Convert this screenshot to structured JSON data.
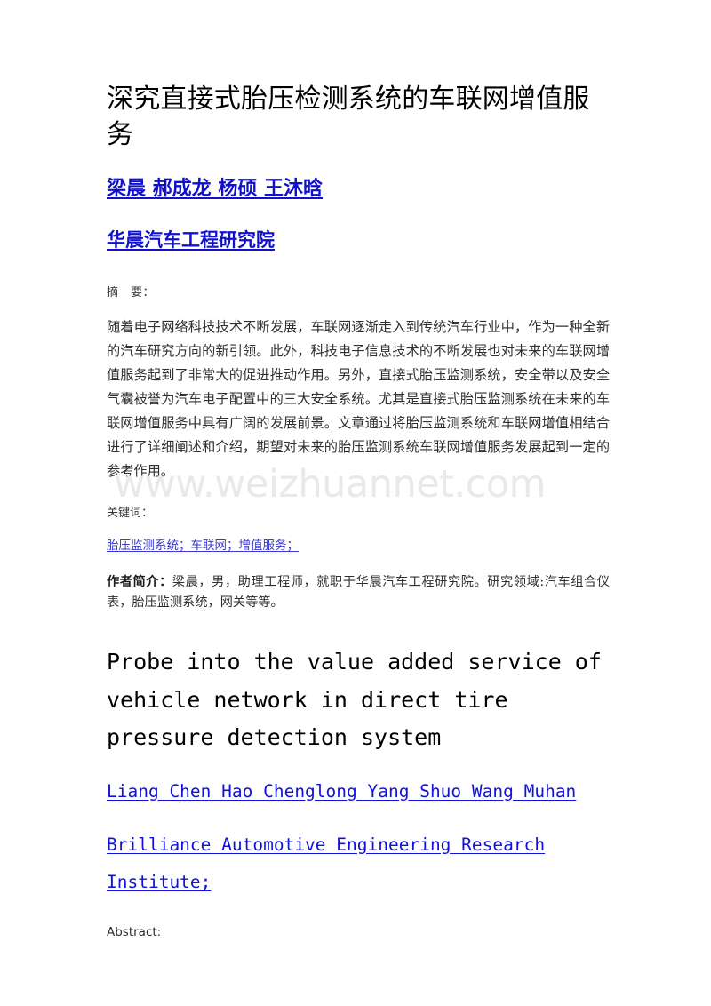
{
  "document": {
    "background_color": "#ffffff",
    "link_color": "#1111cc",
    "body_text_color": "#2f2f2f"
  },
  "chinese": {
    "title": "深究直接式胎压检测系统的车联网增值服务",
    "authors": "梁晨  郝成龙  杨硕  王沐晗",
    "institute": "华晨汽车工程研究院",
    "abstract_label": "摘　要：",
    "abstract_body": "随着电子网络科技技术不断发展，车联网逐渐走入到传统汽车行业中，作为一种全新的汽车研究方向的新引领。此外，科技电子信息技术的不断发展也对未来的车联网增值服务起到了非常大的促进推动作用。另外，直接式胎压监测系统，安全带以及安全气囊被誉为汽车电子配置中的三大安全系统。尤其是直接式胎压监测系统在未来的车联网增值服务中具有广阔的发展前景。文章通过将胎压监测系统和车联网增值相结合进行了详细阐述和介绍，期望对未来的胎压监测系统车联网增值服务发展起到一定的参考作用。",
    "keywords_label": "关键词：",
    "keywords": "胎压监测系统；车联网；增值服务；",
    "bio_label": "作者简介：",
    "bio_body": "梁晨，男，助理工程师，就职于华晨汽车工程研究院。研究领域:汽车组合仪表，胎压监测系统，网关等等。"
  },
  "english": {
    "title": "Probe into the value added service of vehicle network in direct tire pressure detection system",
    "authors": "Liang Chen Hao Chenglong Yang Shuo Wang Muhan",
    "institute": "Brilliance Automotive Engineering Research Institute;",
    "abstract_label": "Abstract:"
  },
  "watermark": {
    "text": "www.weizhuannet.com",
    "color": "#e9e9ec"
  }
}
